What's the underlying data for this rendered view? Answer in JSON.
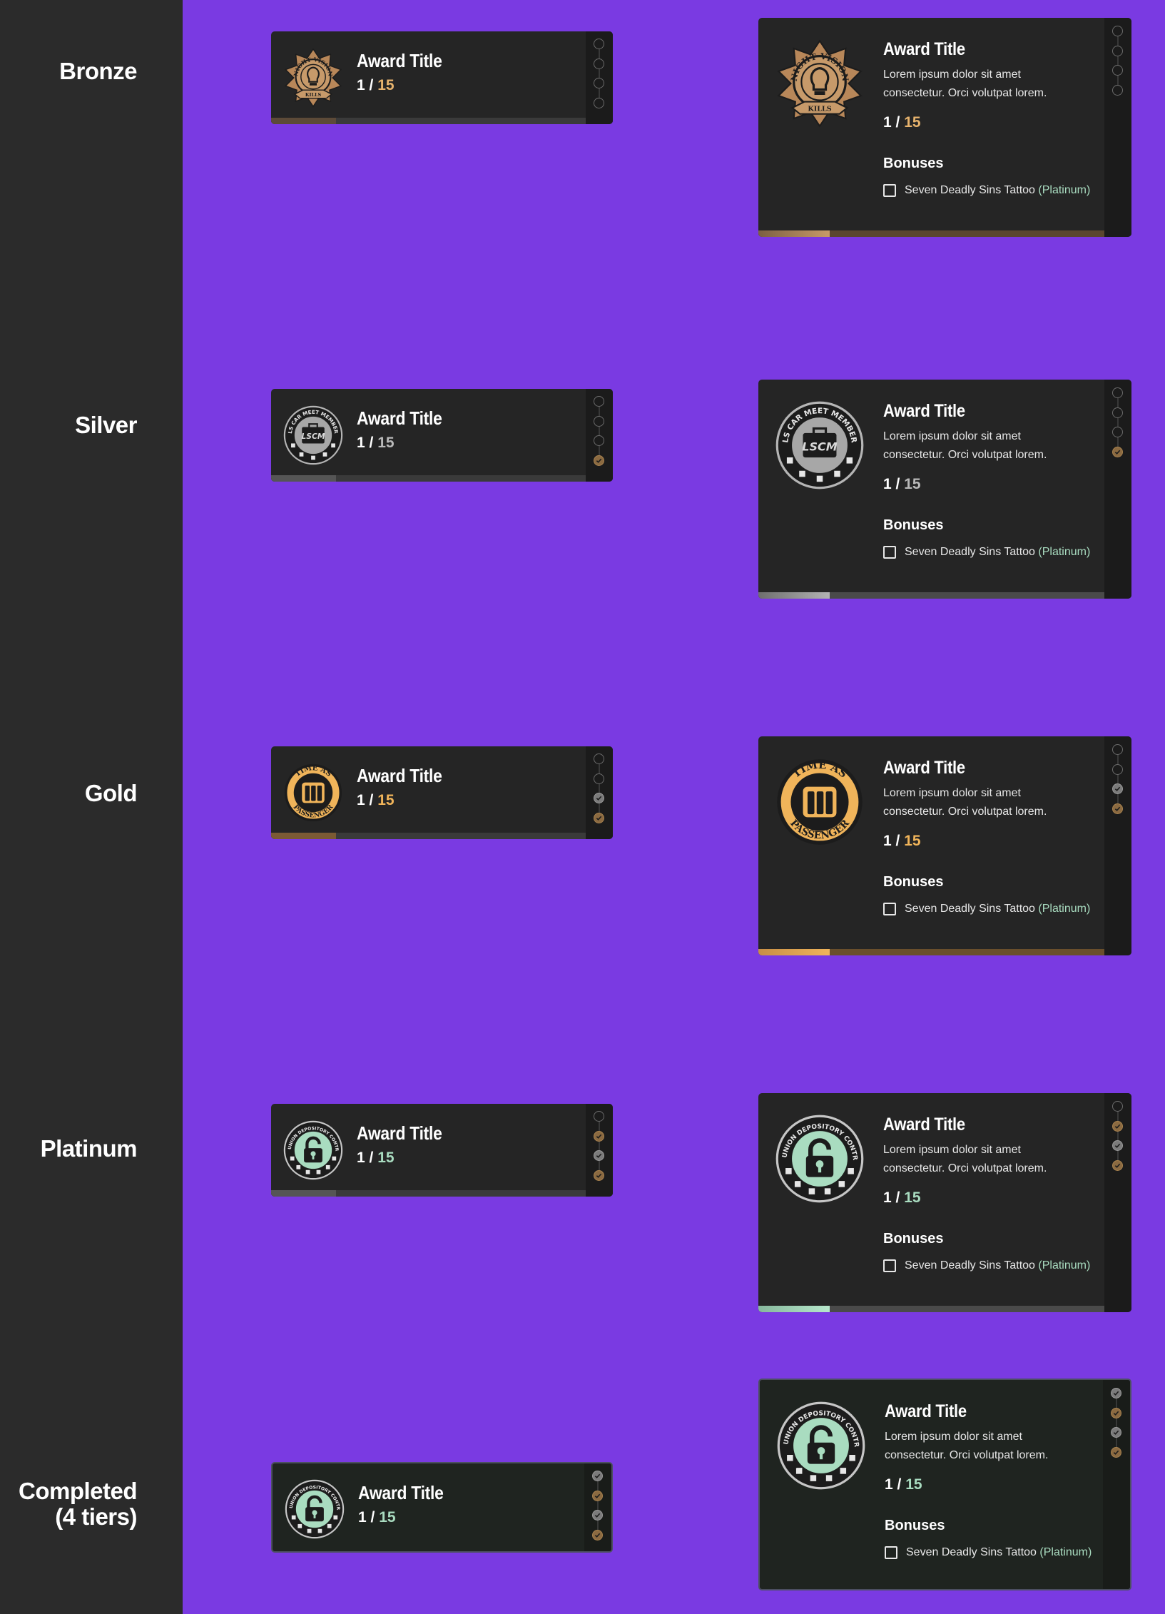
{
  "tiers": [
    {
      "label": "Bronze"
    },
    {
      "label": "Silver"
    },
    {
      "label": "Gold"
    },
    {
      "label": "Platinum"
    },
    {
      "label": "Completed\n(4 tiers)"
    }
  ],
  "card": {
    "title": "Award Title",
    "current": "1",
    "separator": "/",
    "total": "15",
    "description": "Lorem ipsum dolor sit amet consectetur. Orci volutpat lorem.",
    "bonuses_heading": "Bonuses",
    "bonus_item": "Seven Deadly Sins Tattoo",
    "bonus_tier": "(Platinum)"
  },
  "badges": {
    "bronze": {
      "top": "NIGHT VISION",
      "bottom": "KILLS"
    },
    "silver": {
      "top": "LS CAR MEET MEMBER",
      "mid": "LSCM"
    },
    "gold": {
      "top": "TIME AS",
      "bottom": "PASSENGER"
    },
    "platinum": {
      "top": "THE UNION DEPOSITORY CONTRACT"
    }
  },
  "colors": {
    "background": "#7a3ae2",
    "bronze": "#e7b36d",
    "silver": "#b9b9b9",
    "gold": "#f0b45a",
    "platinum": "#a9dcc0",
    "bonus_tier": "#a9dcc0"
  },
  "progress_fraction": 0.0667
}
